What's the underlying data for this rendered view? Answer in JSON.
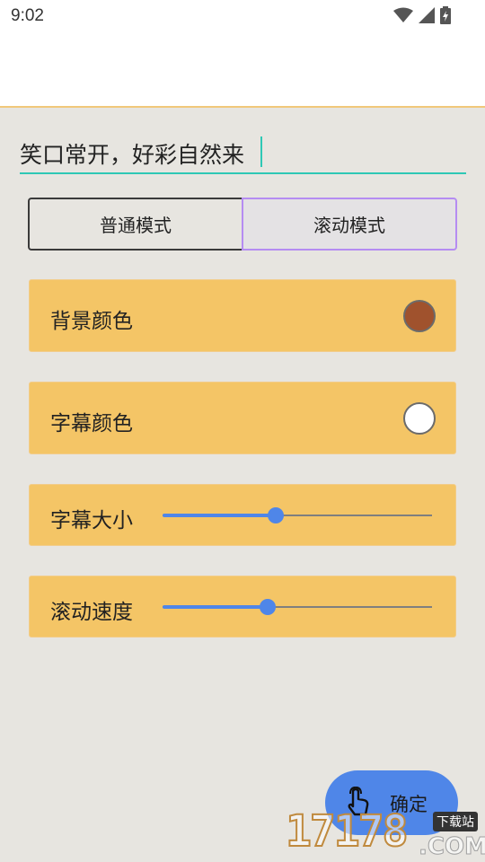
{
  "status_bar": {
    "time": "9:02"
  },
  "subtitle_input": {
    "value": "笑口常开，好彩自然来"
  },
  "modes": {
    "normal_label": "普通模式",
    "scroll_label": "滚动模式",
    "selected": "滚动模式"
  },
  "settings": {
    "background_color": {
      "label": "背景颜色",
      "color": "#a0522d"
    },
    "subtitle_color": {
      "label": "字幕颜色",
      "color": "#ffffff"
    },
    "subtitle_size": {
      "label": "字幕大小",
      "value": 0.42
    },
    "scroll_speed": {
      "label": "滚动速度",
      "value": 0.39
    }
  },
  "confirm": {
    "label": "确定",
    "icon": "tap-hand-icon"
  },
  "watermark": {
    "number": "17178",
    "domain": ".COM",
    "tag": "下载站"
  },
  "colors": {
    "accent": "#4f86e8",
    "card": "#f4c566",
    "input_underline": "#2ec8b5"
  }
}
